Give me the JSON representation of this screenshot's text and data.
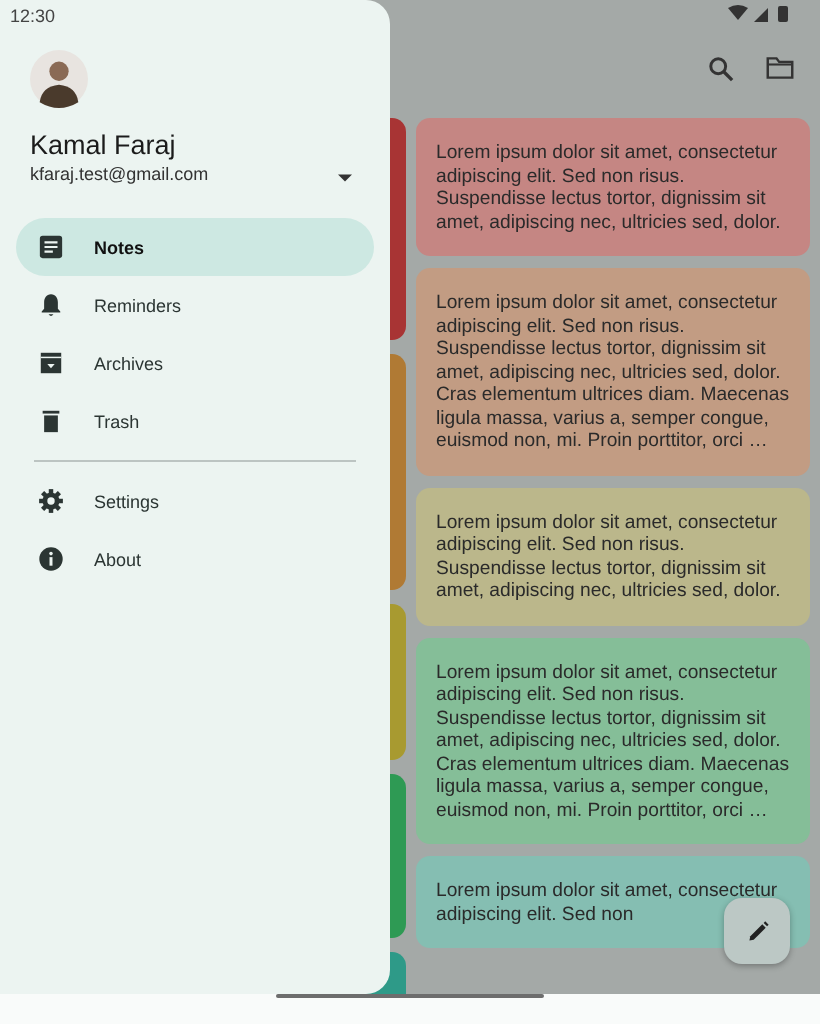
{
  "status_bar": {
    "time": "12:30"
  },
  "drawer": {
    "account": {
      "name": "Kamal Faraj",
      "email": "kfaraj.test@gmail.com"
    },
    "items": [
      {
        "kind": "notes",
        "label": "Notes",
        "selected": true
      },
      {
        "kind": "reminders",
        "label": "Reminders",
        "selected": false
      },
      {
        "kind": "archives",
        "label": "Archives",
        "selected": false
      },
      {
        "kind": "trash",
        "label": "Trash",
        "selected": false
      },
      {
        "kind": "divider"
      },
      {
        "kind": "settings",
        "label": "Settings",
        "selected": false
      },
      {
        "kind": "about",
        "label": "About",
        "selected": false
      }
    ]
  },
  "notes_left_column": [
    {
      "color": "#a83434"
    },
    {
      "color": "#b07a34"
    },
    {
      "color": "#a89a30"
    },
    {
      "color": "#2e9a54"
    },
    {
      "color": "#2e9a88"
    }
  ],
  "notes": [
    {
      "color": "#c58683",
      "text": "Lorem ipsum dolor sit amet, consectetur adipiscing elit. Sed non risus. Suspendisse lectus tortor, dignissim sit amet, adipiscing nec, ultricies sed, dolor."
    },
    {
      "color": "#c29c83",
      "text": "Lorem ipsum dolor sit amet, consectetur adipiscing elit. Sed non risus. Suspendisse lectus tortor, dignissim sit amet, adipiscing nec, ultricies sed, dolor. Cras elementum ultrices diam. Maecenas ligula massa, varius a, semper congue, euismod non, mi. Proin porttitor, orci …"
    },
    {
      "color": "#bbb78b",
      "text": "Lorem ipsum dolor sit amet, consectetur adipiscing elit. Sed non risus. Suspendisse lectus tortor, dignissim sit amet, adipiscing nec, ultricies sed, dolor."
    },
    {
      "color": "#85be98",
      "text": "Lorem ipsum dolor sit amet, consectetur adipiscing elit. Sed non risus. Suspendisse lectus tortor, dignissim sit amet, adipiscing nec, ultricies sed, dolor. Cras elementum ultrices diam. Maecenas ligula massa, varius a, semper congue, euismod non, mi. Proin porttitor, orci …"
    },
    {
      "color": "#85beb2",
      "text": "Lorem ipsum dolor sit amet, consectetur adipiscing elit. Sed non"
    }
  ]
}
